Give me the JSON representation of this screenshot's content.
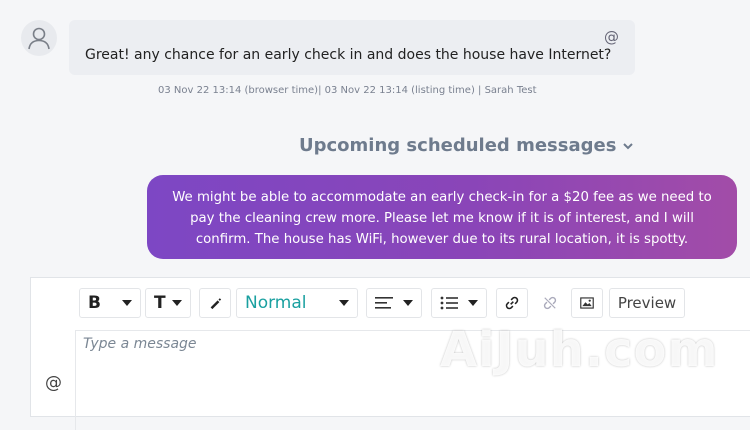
{
  "conversation": {
    "incoming": {
      "text": "Great! any chance for an early check in and does the house have Internet?",
      "mention_symbol": "@",
      "meta": "03 Nov 22 13:14 (browser time)| 03 Nov 22 13:14 (listing time) | Sarah Test"
    },
    "upcoming_label": "Upcoming scheduled messages",
    "outgoing": {
      "text": "We might be able to accommodate an early check-in for a $20 fee as we need to pay the cleaning crew more. Please let me know if it is of interest, and I will confirm. The house has WiFi, however due to its rural location, it is spotty."
    }
  },
  "composer": {
    "toolbar": {
      "bold_label": "B",
      "text_size_label": "T",
      "format_value": "Normal",
      "preview_label": "Preview"
    },
    "placeholder": "Type a message",
    "mention_symbol": "@"
  },
  "watermark": "AiJuh.com",
  "colors": {
    "bubble_gradient_start": "#7d47c4",
    "bubble_gradient_end": "#a24ca8",
    "accent_teal": "#1aa0a0",
    "heading_gray": "#6e7b8d"
  }
}
